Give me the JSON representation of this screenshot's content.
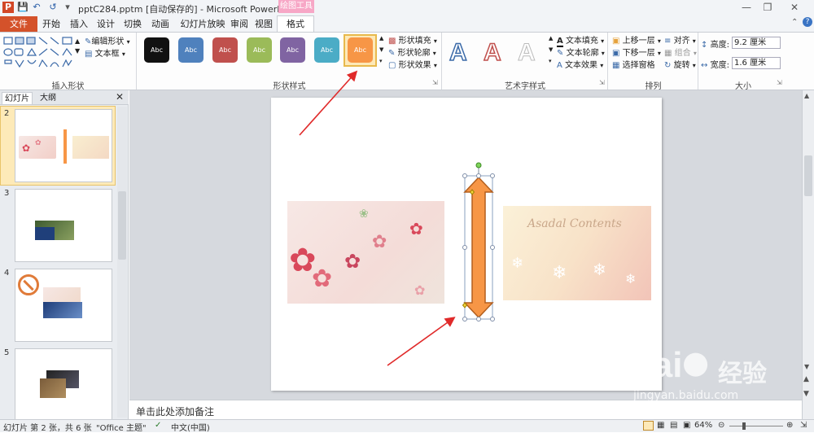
{
  "title": "pptC284.pptm [自动保存的] - Microsoft PowerPoint",
  "context_label": "绘图工具",
  "tabs": [
    "文件",
    "开始",
    "插入",
    "设计",
    "切换",
    "动画",
    "幻灯片放映",
    "审阅",
    "视图",
    "格式"
  ],
  "ribbon": {
    "insert_shapes": {
      "label": "插入形状",
      "edit_shape": "编辑形状",
      "text_box": "文本框"
    },
    "shape_styles": {
      "label": "形状样式",
      "swatch_text": "Abc",
      "fill": "形状填充",
      "outline": "形状轮廓",
      "effects": "形状效果"
    },
    "swatch_colors": [
      "#111111",
      "#4f81bd",
      "#c0504d",
      "#9bbb59",
      "#8064a2",
      "#4bacc6",
      "#f79646"
    ],
    "wordart": {
      "label": "艺术字样式",
      "text_fill": "文本填充",
      "text_outline": "文本轮廓",
      "text_effects": "文本效果"
    },
    "arrange": {
      "label": "排列",
      "bring_forward": "上移一层",
      "send_backward": "下移一层",
      "selection_pane": "选择窗格",
      "align": "对齐",
      "group": "组合",
      "rotate": "旋转"
    },
    "size": {
      "label": "大小",
      "height_label": "高度:",
      "height_value": "9.2 厘米",
      "width_label": "宽度:",
      "width_value": "1.6 厘米"
    }
  },
  "left_pane": {
    "tab_slides": "幻灯片",
    "tab_outline": "大纲",
    "slide_numbers": [
      "2",
      "3",
      "4",
      "5"
    ]
  },
  "notes_placeholder": "单击此处添加备注",
  "status": {
    "slide_info": "幻灯片 第 2 张，共 6 张",
    "theme": "\"Office 主题\"",
    "language": "中文(中国)",
    "zoom": "64%"
  },
  "watermark": {
    "brand": "Bai",
    "brand_suffix": "经验",
    "url": "jingyan.baidu.com"
  },
  "image_text": "Asadal Contents"
}
